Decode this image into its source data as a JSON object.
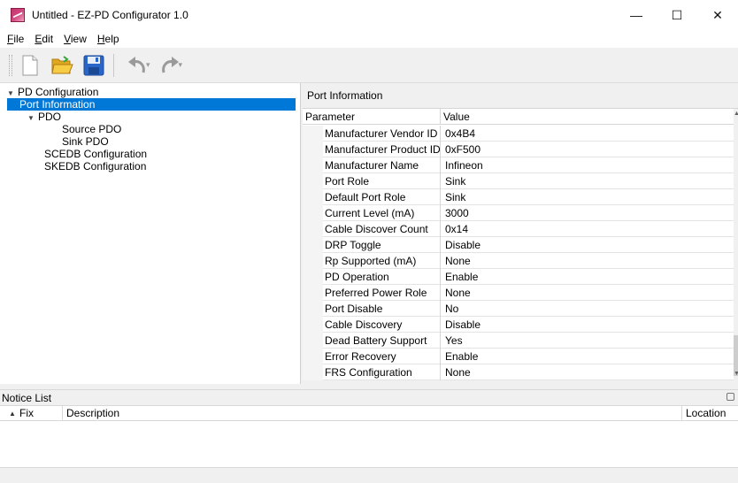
{
  "window": {
    "title": "Untitled - EZ-PD Configurator 1.0",
    "controls": {
      "minimize": "—",
      "maximize": "☐",
      "close": "✕"
    }
  },
  "menu": [
    {
      "label": "File",
      "accel": "F",
      "rest": "ile"
    },
    {
      "label": "Edit",
      "accel": "E",
      "rest": "dit"
    },
    {
      "label": "View",
      "accel": "V",
      "rest": "iew"
    },
    {
      "label": "Help",
      "accel": "H",
      "rest": "elp"
    }
  ],
  "toolbar": {
    "icons": [
      "new-file-icon",
      "open-folder-icon",
      "save-icon",
      "undo-icon",
      "redo-icon"
    ],
    "colors": {
      "folder": "#f2c12e",
      "save": "#2a66c8",
      "undo": "#9a9a9a"
    }
  },
  "tree": {
    "root": "PD Configuration",
    "port_information": "Port Information",
    "pdo": "PDO",
    "source_pdo": "Source PDO",
    "sink_pdo": "Sink PDO",
    "scedb": "SCEDB Configuration",
    "skedb": "SKEDB Configuration",
    "selected": "Port Information",
    "selection_color": "#0078d7"
  },
  "panel": {
    "title": "Port Information",
    "columns": {
      "parameter": "Parameter",
      "value": "Value"
    },
    "rows": [
      {
        "param": "Manufacturer Vendor ID",
        "value": "0x4B4"
      },
      {
        "param": "Manufacturer Product ID",
        "value": "0xF500"
      },
      {
        "param": "Manufacturer Name",
        "value": "Infineon"
      },
      {
        "param": "Port Role",
        "value": "Sink"
      },
      {
        "param": "Default Port Role",
        "value": "Sink"
      },
      {
        "param": "Current Level (mA)",
        "value": "3000"
      },
      {
        "param": "Cable Discover Count",
        "value": "0x14"
      },
      {
        "param": "DRP Toggle",
        "value": "Disable"
      },
      {
        "param": "Rp Supported (mA)",
        "value": "None"
      },
      {
        "param": "PD Operation",
        "value": "Enable"
      },
      {
        "param": "Preferred Power Role",
        "value": "None"
      },
      {
        "param": "Port Disable",
        "value": "No"
      },
      {
        "param": "Cable Discovery",
        "value": "Disable"
      },
      {
        "param": "Dead Battery Support",
        "value": "Yes"
      },
      {
        "param": "Error Recovery",
        "value": "Enable"
      },
      {
        "param": "FRS Configuration",
        "value": "None"
      }
    ]
  },
  "notice": {
    "title": "Notice List",
    "columns": {
      "fix": "Fix",
      "description": "Description",
      "location": "Location"
    }
  }
}
